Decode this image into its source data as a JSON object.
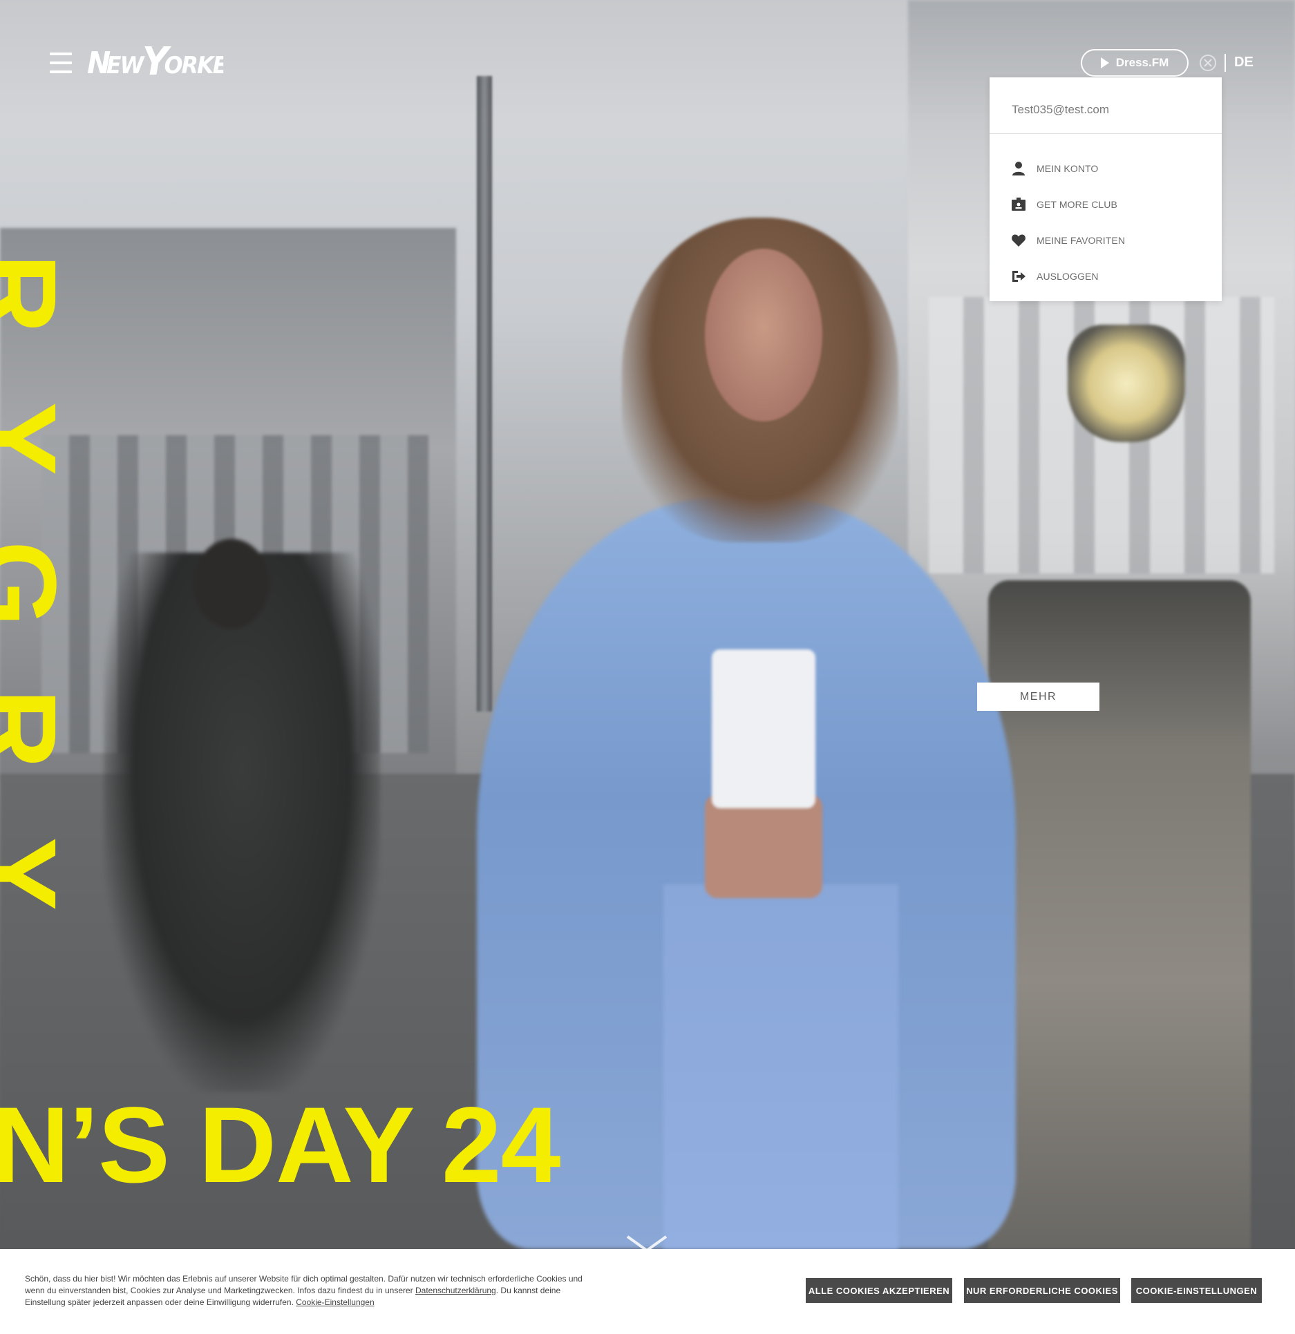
{
  "header": {
    "logo_text": "NewYorker",
    "radio_label": "Dress.FM",
    "language": "DE"
  },
  "account_menu": {
    "email": "Test035@test.com",
    "items": [
      {
        "label": "MEIN KONTO",
        "icon": "user-icon"
      },
      {
        "label": "GET MORE CLUB",
        "icon": "member-card-icon"
      },
      {
        "label": "MEINE FAVORITEN",
        "icon": "heart-icon"
      },
      {
        "label": "AUSLOGGEN",
        "icon": "logout-icon"
      }
    ]
  },
  "hero": {
    "vertical_text": [
      "R",
      "Y",
      "G",
      "R",
      "Y",
      "."
    ],
    "campaign_text": "N’S DAY 24",
    "cta_label": "MEHR",
    "accent_color": "#f5ed00"
  },
  "cookie_banner": {
    "text_part1": "Schön, dass du hier bist! Wir möchten das Erlebnis auf unserer Website für dich optimal gestalten. Dafür nutzen wir technisch erforderliche Cookies und wenn du einverstanden bist, Cookies zur Analyse und Marketingzwecken. Infos dazu findest du in unserer ",
    "privacy_link": "Datenschutzerklärung",
    "text_part2": ". Du kannst deine Einstellung später jederzeit anpassen oder deine Einwilligung widerrufen. ",
    "settings_link": "Cookie-Einstellungen",
    "accept_all_label": "ALLE COOKIES AKZEPTIEREN",
    "necessary_only_label": "NUR ERFORDERLICHE COOKIES",
    "settings_label": "COOKIE-EINSTELLUNGEN"
  }
}
